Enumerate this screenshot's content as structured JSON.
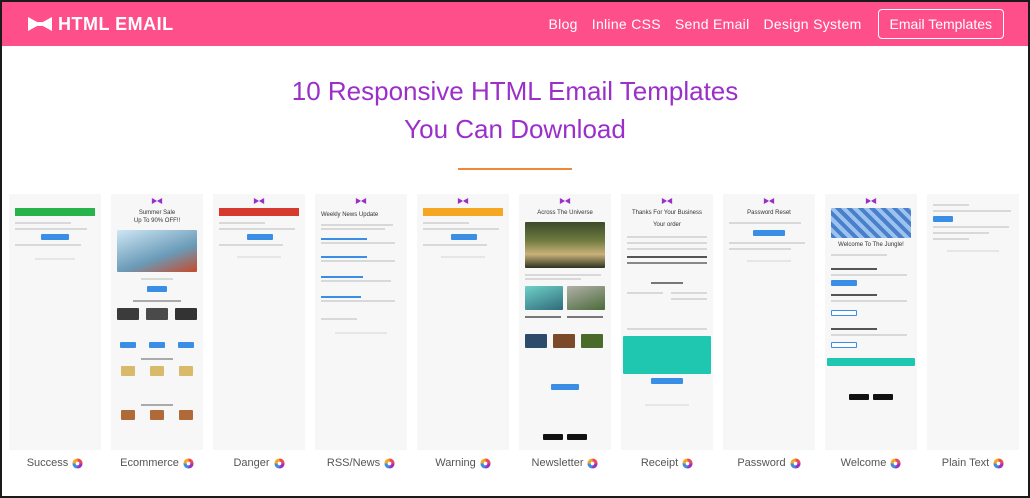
{
  "header": {
    "brand": "HTML EMAIL",
    "nav": [
      "Blog",
      "Inline CSS",
      "Send Email",
      "Design System"
    ],
    "cta": "Email Templates",
    "bg_color": "#ff4f8b"
  },
  "hero": {
    "line1": "10 Responsive HTML Email Templates",
    "line2": "You Can Download",
    "title_color": "#9b2fc9",
    "rule_color": "#f0883a"
  },
  "templates": [
    {
      "label": "Success",
      "accent": "#25b34a"
    },
    {
      "label": "Ecommerce",
      "accent": "#3a8ee6",
      "heading": "Summer Sale",
      "subheading": "Up To 90% OFF!!"
    },
    {
      "label": "Danger",
      "accent": "#d63a2f"
    },
    {
      "label": "RSS/News",
      "accent": "#3a8ee6",
      "heading": "Weekly News Update"
    },
    {
      "label": "Warning",
      "accent": "#f5a623"
    },
    {
      "label": "Newsletter",
      "accent": "#3a8ee6",
      "heading": "Across The Universe"
    },
    {
      "label": "Receipt",
      "accent": "#1fc7b0",
      "heading": "Thanks For Your Business",
      "subheading": "Your order"
    },
    {
      "label": "Password",
      "accent": "#3a8ee6",
      "heading": "Password Reset"
    },
    {
      "label": "Welcome",
      "accent": "#1fc7b0",
      "heading": "Welcome To The Jungle!"
    },
    {
      "label": "Plain Text",
      "accent": "#3a8ee6"
    }
  ],
  "icons": {
    "logo": "bow-tie-icon",
    "label_icon": "color-wheel-icon"
  }
}
